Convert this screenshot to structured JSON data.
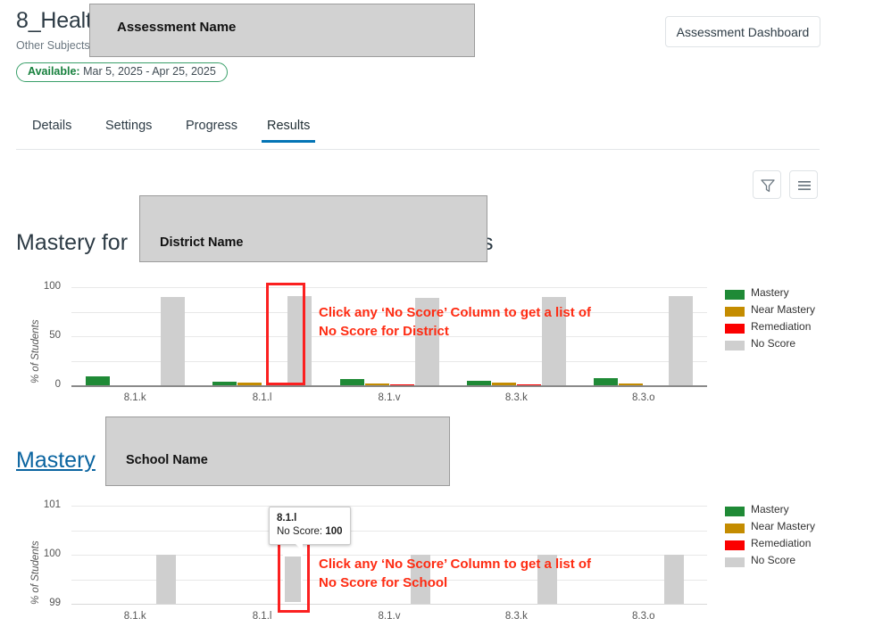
{
  "header": {
    "title": "8_Healt",
    "subject": "Other Subjects",
    "separator": "|",
    "availability_label": "Available:",
    "availability_dates": "Mar 5, 2025 - Apr 25, 2025",
    "dashboard_button": "Assessment Dashboard",
    "redaction_assessment_name": "Assessment Name"
  },
  "tabs": [
    {
      "label": "Details",
      "active": false
    },
    {
      "label": "Settings",
      "active": false
    },
    {
      "label": "Progress",
      "active": false
    },
    {
      "label": "Results",
      "active": true
    }
  ],
  "toolbar": {
    "filter_icon": "filter-funnel-icon",
    "menu_icon": "hamburger-menu-icon"
  },
  "district_section": {
    "title_prefix": "Mastery for",
    "title_suffix": "s",
    "redaction_label": "District Name",
    "annotation_line1": "Click any ‘No Score’ Column to get a list of",
    "annotation_line2": "No Score for District"
  },
  "school_section": {
    "title_link": "Mastery ",
    "redaction_label": "School Name",
    "annotation_line1": "Click any ‘No Score’ Column to get a list of",
    "annotation_line2": "No Score for School",
    "tooltip_title": "8.1.l",
    "tooltip_metric_label": "No Score:",
    "tooltip_metric_value": "100"
  },
  "colors": {
    "mastery": "#1f8a36",
    "near_mastery": "#c48c00",
    "remediation": "#fb0000",
    "no_score": "#cfcfcf",
    "accent_tab": "#0374b5",
    "annotation": "#fe2b12",
    "highlight_box": "#fb2020",
    "link": "#0a64a0",
    "available_green": "#17803d"
  },
  "chart_data": [
    {
      "id": "district-mastery-chart",
      "type": "bar",
      "title": "Mastery for District Name s",
      "xlabel": "",
      "ylabel": "% of Students",
      "categories": [
        "8.1.k",
        "8.1.l",
        "8.1.v",
        "8.3.k",
        "8.3.o"
      ],
      "ylim": [
        0,
        100
      ],
      "yticks": [
        0,
        50,
        100
      ],
      "gridlines": [
        0,
        25,
        50,
        75,
        100
      ],
      "grid": true,
      "legend_position": "right",
      "series": [
        {
          "name": "Mastery",
          "color": "#1f8a36",
          "values": [
            9,
            4,
            6,
            5,
            7
          ]
        },
        {
          "name": "Near Mastery",
          "color": "#c48c00",
          "values": [
            0,
            3,
            2,
            3,
            2
          ]
        },
        {
          "name": "Remediation",
          "color": "#fb0000",
          "values": [
            0,
            0,
            1,
            1,
            0
          ]
        },
        {
          "name": "No Score",
          "color": "#cfcfcf",
          "values": [
            90,
            91,
            89,
            90,
            91
          ]
        }
      ],
      "highlighted_category": "8.1.l",
      "highlighted_series": "No Score"
    },
    {
      "id": "school-mastery-chart",
      "type": "bar",
      "title": "Mastery School Name",
      "xlabel": "",
      "ylabel": "% of Students",
      "categories": [
        "8.1.k",
        "8.1.l",
        "8.1.v",
        "8.3.k",
        "8.3.o"
      ],
      "ylim": [
        99,
        101
      ],
      "yticks": [
        99,
        100,
        101
      ],
      "gridlines": [
        99,
        99.5,
        100,
        100.5,
        101
      ],
      "grid": true,
      "legend_position": "right",
      "series": [
        {
          "name": "Mastery",
          "color": "#1f8a36",
          "values": [
            0,
            0,
            0,
            0,
            0
          ]
        },
        {
          "name": "Near Mastery",
          "color": "#c48c00",
          "values": [
            0,
            0,
            0,
            0,
            0
          ]
        },
        {
          "name": "Remediation",
          "color": "#fb0000",
          "values": [
            0,
            0,
            0,
            0,
            0
          ]
        },
        {
          "name": "No Score",
          "color": "#cfcfcf",
          "values": [
            100,
            100,
            100,
            100,
            100
          ]
        }
      ],
      "highlighted_category": "8.1.l",
      "highlighted_series": "No Score",
      "tooltip": {
        "category": "8.1.l",
        "label": "No Score:",
        "value": "100"
      }
    }
  ]
}
